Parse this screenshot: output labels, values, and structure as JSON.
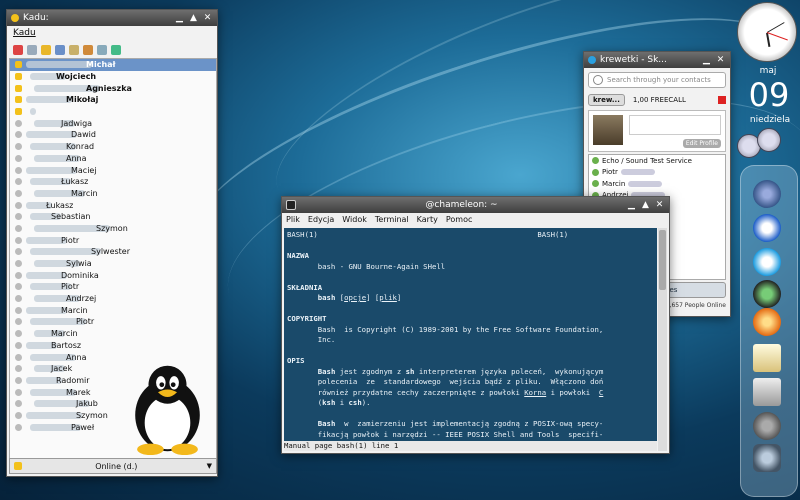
{
  "kadu": {
    "title": "Kadu:",
    "menu": "Kadu",
    "status": "Online (d.)",
    "contacts": [
      {
        "name": "Michał",
        "indent": 60,
        "state": "selected"
      },
      {
        "name": "Wojciech",
        "indent": 30,
        "state": "online-bold"
      },
      {
        "name": "Agnieszka",
        "indent": 60,
        "state": "online-bold"
      },
      {
        "name": "Mikołaj",
        "indent": 40,
        "state": "online-bold"
      },
      {
        "name": "",
        "indent": 0,
        "state": "online"
      },
      {
        "name": "Jadwiga",
        "indent": 35,
        "state": "offline"
      },
      {
        "name": "Dawid",
        "indent": 45,
        "state": "offline"
      },
      {
        "name": "Konrad",
        "indent": 40,
        "state": "offline"
      },
      {
        "name": "Anna",
        "indent": 40,
        "state": "offline"
      },
      {
        "name": "Maciej",
        "indent": 45,
        "state": "offline"
      },
      {
        "name": "Łukasz",
        "indent": 35,
        "state": "offline"
      },
      {
        "name": "Marcin",
        "indent": 45,
        "state": "offline"
      },
      {
        "name": "Łukasz",
        "indent": 20,
        "state": "offline"
      },
      {
        "name": "Sebastian",
        "indent": 25,
        "state": "offline"
      },
      {
        "name": "Szymon",
        "indent": 70,
        "state": "offline"
      },
      {
        "name": "Piotr",
        "indent": 35,
        "state": "offline"
      },
      {
        "name": "Sylwester",
        "indent": 65,
        "state": "offline"
      },
      {
        "name": "Sylwia",
        "indent": 40,
        "state": "offline"
      },
      {
        "name": "Dominika",
        "indent": 35,
        "state": "offline"
      },
      {
        "name": "Piotr",
        "indent": 35,
        "state": "offline"
      },
      {
        "name": "Andrzej",
        "indent": 40,
        "state": "offline"
      },
      {
        "name": "Marcin",
        "indent": 35,
        "state": "offline"
      },
      {
        "name": "Piotr",
        "indent": 50,
        "state": "offline"
      },
      {
        "name": "Marcin",
        "indent": 25,
        "state": "offline"
      },
      {
        "name": "Bartosz",
        "indent": 25,
        "state": "offline"
      },
      {
        "name": "Anna",
        "indent": 40,
        "state": "offline"
      },
      {
        "name": "Jacek",
        "indent": 25,
        "state": "offline"
      },
      {
        "name": "Radomir",
        "indent": 30,
        "state": "offline"
      },
      {
        "name": "Marek",
        "indent": 40,
        "state": "offline"
      },
      {
        "name": "Jakub",
        "indent": 50,
        "state": "offline"
      },
      {
        "name": "Szymon",
        "indent": 50,
        "state": "offline"
      },
      {
        "name": "Paweł",
        "indent": 45,
        "state": "offline"
      }
    ]
  },
  "skype": {
    "title": "krewetki - Sk...",
    "search_placeholder": "Search through your contacts",
    "user": "krew...",
    "credit": "1,00 FREECALL",
    "edit_profile": "Edit Profile",
    "contacts": [
      "Echo / Sound Test Service",
      "Piotr",
      "Marcin",
      "Andrzej",
      "Konrad",
      "",
      "",
      "Mikołaj",
      "Paweł",
      "Radomir",
      ""
    ],
    "calls_button": "Call phones",
    "online_count": "1,994,657 People Online"
  },
  "terminal": {
    "title": "@chameleon: ~",
    "menu": [
      "Plik",
      "Edycja",
      "Widok",
      "Terminal",
      "Karty",
      "Pomoc"
    ],
    "status": "Manual page bash(1) line 1"
  },
  "clock": {
    "month": "maj",
    "day": "09",
    "weekday": "niedziela"
  },
  "dock_icons": [
    "browser-icon",
    "firefox-icon",
    "skype-icon",
    "music-icon",
    "vlc-icon",
    "notes-icon",
    "calculator-icon",
    "gimp-icon",
    "system-icon"
  ]
}
